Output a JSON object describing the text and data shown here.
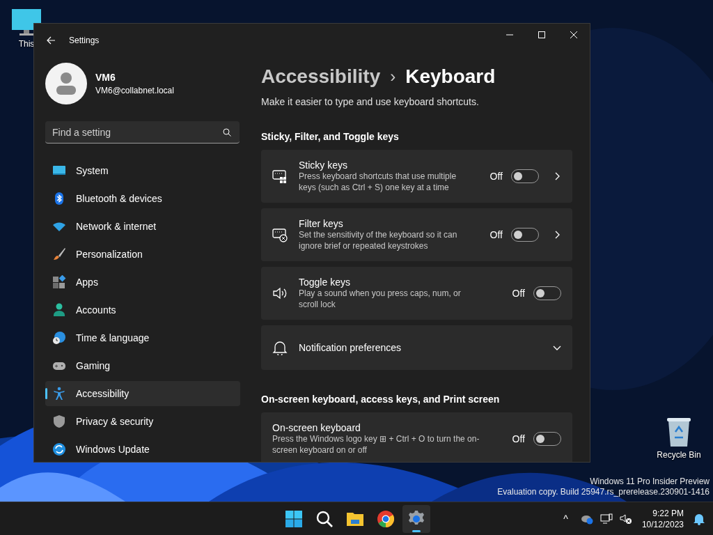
{
  "desktop_icons": [
    {
      "kind": "pc",
      "label": "This"
    },
    {
      "kind": "recycle",
      "label": "Recycle Bin"
    }
  ],
  "window": {
    "title": "Settings",
    "user": {
      "name": "VM6",
      "email": "VM6@collabnet.local"
    },
    "search": {
      "placeholder": "Find a setting"
    },
    "nav": [
      {
        "kind": "system",
        "label": "System",
        "selected": false
      },
      {
        "kind": "bluetooth",
        "label": "Bluetooth & devices",
        "selected": false
      },
      {
        "kind": "network",
        "label": "Network & internet",
        "selected": false
      },
      {
        "kind": "personalization",
        "label": "Personalization",
        "selected": false
      },
      {
        "kind": "apps",
        "label": "Apps",
        "selected": false
      },
      {
        "kind": "accounts",
        "label": "Accounts",
        "selected": false
      },
      {
        "kind": "time",
        "label": "Time & language",
        "selected": false
      },
      {
        "kind": "gaming",
        "label": "Gaming",
        "selected": false
      },
      {
        "kind": "accessibility",
        "label": "Accessibility",
        "selected": true
      },
      {
        "kind": "privacy",
        "label": "Privacy & security",
        "selected": false
      },
      {
        "kind": "update",
        "label": "Windows Update",
        "selected": false
      }
    ],
    "breadcrumb": {
      "parent": "Accessibility",
      "separator": "›",
      "current": "Keyboard"
    },
    "description": "Make it easier to type and use keyboard shortcuts.",
    "sections": [
      {
        "heading": "Sticky, Filter, and Toggle keys",
        "cards": [
          {
            "kind": "sticky",
            "title": "Sticky keys",
            "description": "Press keyboard shortcuts that use multiple keys (such as Ctrl + S) one key at a time",
            "state": "Off",
            "on": false,
            "link": true
          },
          {
            "kind": "filter",
            "title": "Filter keys",
            "description": "Set the sensitivity of the keyboard so it can ignore brief or repeated keystrokes",
            "state": "Off",
            "on": false,
            "link": true
          },
          {
            "kind": "sound",
            "title": "Toggle keys",
            "description": "Play a sound when you press caps, num, or scroll lock",
            "state": "Off",
            "on": false,
            "link": false
          },
          {
            "kind": "bell",
            "title": "Notification preferences",
            "expanded": false
          }
        ]
      },
      {
        "heading": "On-screen keyboard, access keys, and Print screen",
        "cards": [
          {
            "kind": "plain",
            "title": "On-screen keyboard",
            "description": "Press the Windows logo key ⊞ + Ctrl + O to turn the on-screen keyboard on or off",
            "state": "Off",
            "on": false,
            "link": false
          }
        ]
      }
    ]
  },
  "watermark": [
    "Windows 11 Pro Insider Preview",
    "Evaluation copy. Build 25947.rs_prerelease.230901-1416"
  ],
  "taskbar": {
    "apps": [
      {
        "kind": "start",
        "selected": false
      },
      {
        "kind": "search",
        "selected": false
      },
      {
        "kind": "explorer",
        "selected": false
      },
      {
        "kind": "browser",
        "selected": false
      },
      {
        "kind": "settings",
        "selected": true
      }
    ],
    "tray": {
      "chevron": "^",
      "time": "9:22 PM",
      "date": "10/12/2023"
    }
  }
}
